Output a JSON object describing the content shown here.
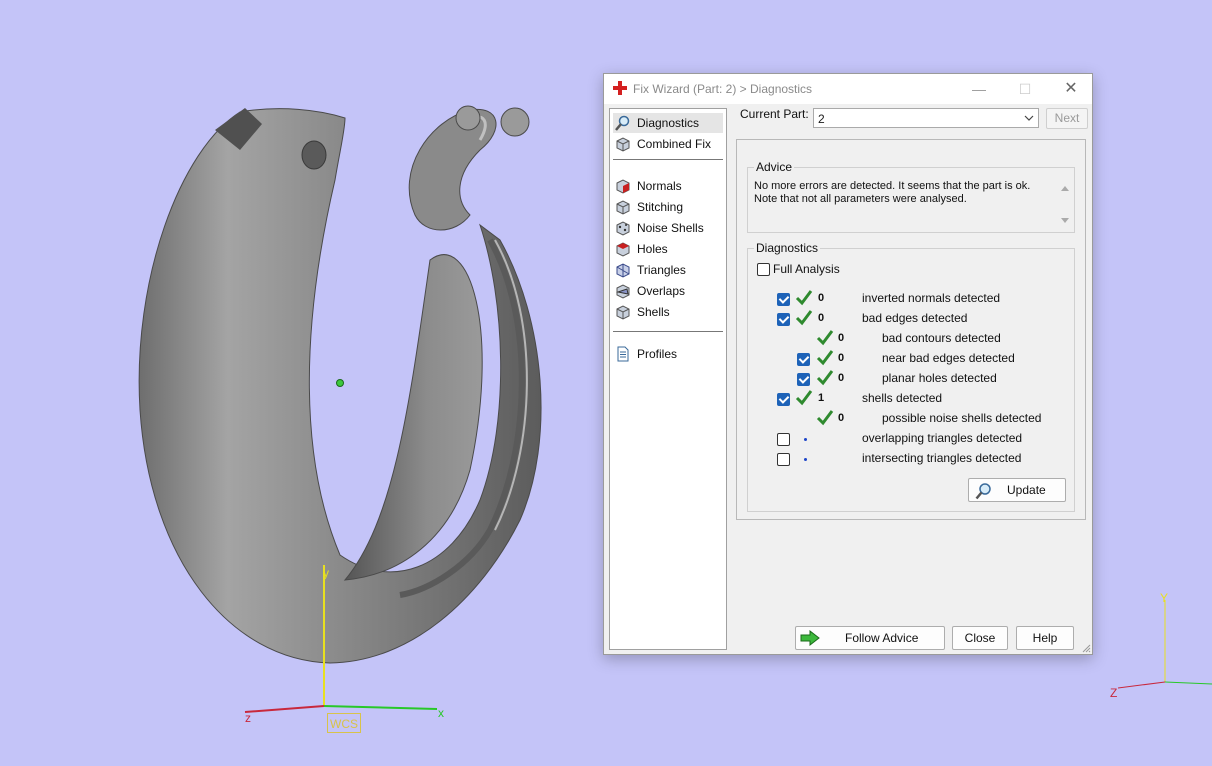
{
  "viewport": {
    "wcs_label": "WCS",
    "axes": {
      "x": "x",
      "y": "y",
      "z": "z"
    },
    "mini_axes": {
      "y": "Y",
      "z": "Z"
    }
  },
  "window": {
    "title": "Fix Wizard (Part: 2) > Diagnostics",
    "controls": {
      "minimize": "—",
      "maximize": "☐",
      "close": "✕"
    }
  },
  "nav": {
    "items": [
      {
        "label": "Diagnostics",
        "icon": "magnifier-icon",
        "selected": true
      },
      {
        "label": "Combined Fix",
        "icon": "cube-icon"
      },
      {
        "label": "Normals",
        "icon": "normals-cube-icon"
      },
      {
        "label": "Stitching",
        "icon": "stitching-cube-icon"
      },
      {
        "label": "Noise Shells",
        "icon": "noise-shells-icon"
      },
      {
        "label": "Holes",
        "icon": "holes-cube-icon"
      },
      {
        "label": "Triangles",
        "icon": "triangles-icon"
      },
      {
        "label": "Overlaps",
        "icon": "overlaps-icon"
      },
      {
        "label": "Shells",
        "icon": "shells-icon"
      },
      {
        "label": "Profiles",
        "icon": "document-icon"
      }
    ]
  },
  "header": {
    "current_part_label": "Current Part:",
    "current_part_value": "2",
    "next_label": "Next"
  },
  "advice": {
    "title": "Advice",
    "line1": "No more errors are detected. It seems that the part is ok.",
    "line2": "Note that not all parameters were analysed."
  },
  "diagnostics": {
    "title": "Diagnostics",
    "full_analysis_label": "Full Analysis",
    "rows": [
      {
        "checked": true,
        "status": "ok",
        "count": "0",
        "text": "inverted normals detected"
      },
      {
        "checked": true,
        "status": "ok",
        "count": "0",
        "text": "bad edges detected"
      },
      {
        "checked": null,
        "status": "ok",
        "count": "0",
        "text": "bad contours detected"
      },
      {
        "checked": true,
        "status": "ok",
        "count": "0",
        "text": "near bad edges detected"
      },
      {
        "checked": true,
        "status": "ok",
        "count": "0",
        "text": "planar holes detected"
      },
      {
        "checked": true,
        "status": "ok",
        "count": "1",
        "text": "shells detected"
      },
      {
        "checked": null,
        "status": "ok",
        "count": "0",
        "text": "possible noise shells detected"
      },
      {
        "checked": false,
        "status": "not-run",
        "count": "",
        "text": "overlapping triangles detected"
      },
      {
        "checked": false,
        "status": "not-run",
        "count": "",
        "text": "intersecting triangles detected"
      }
    ],
    "update_label": "Update"
  },
  "footer": {
    "follow_advice_label": "Follow Advice",
    "close_label": "Close",
    "help_label": "Help"
  },
  "colors": {
    "viewport_bg": "#c4c4f8",
    "check_green": "#2f8a2f",
    "checkbox_blue": "#1e63b8",
    "axis_x": "#28c828",
    "axis_y": "#e8e020",
    "axis_z": "#c8283c"
  }
}
